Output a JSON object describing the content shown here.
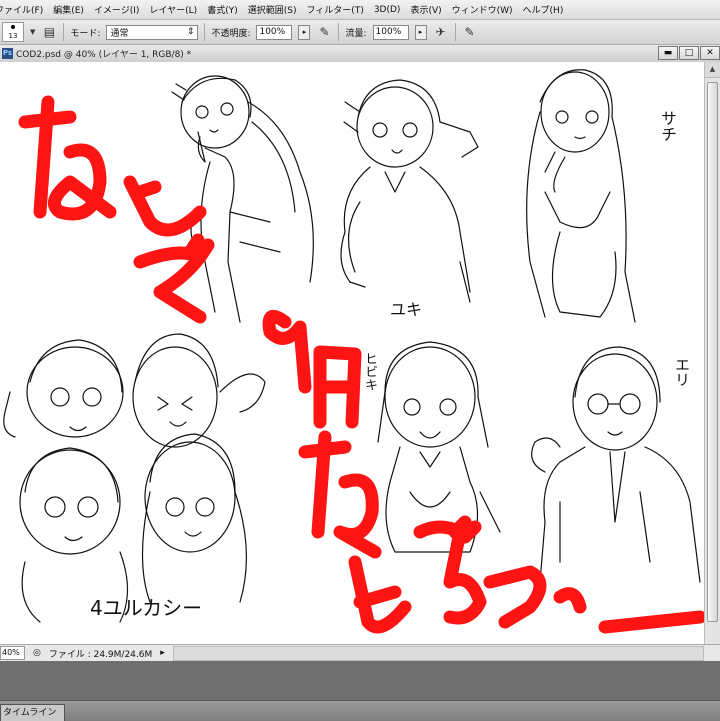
{
  "menubar": {
    "items": [
      "ファイル(F)",
      "編集(E)",
      "イメージ(I)",
      "レイヤー(L)",
      "書式(Y)",
      "選択範囲(S)",
      "フィルター(T)",
      "3D(D)",
      "表示(V)",
      "ウィンドウ(W)",
      "ヘルプ(H)"
    ]
  },
  "options": {
    "brush_size": "13",
    "mode_label": "モード:",
    "mode_value": "通常",
    "opacity_label": "不透明度:",
    "opacity_value": "100%",
    "flow_label": "流量:",
    "flow_value": "100%"
  },
  "document": {
    "title": "COD2.psd @ 40% (レイヤー 1, RGB/8) *",
    "ps_icon": "Ps"
  },
  "window_buttons": {
    "minimize": "▬",
    "restore": "□",
    "close": "✕"
  },
  "canvas": {
    "sketch_labels": {
      "yuki": "ユキ",
      "sachi": "サチ",
      "hibiki": "ヒビキ",
      "eri": "エリ",
      "quartet": "4ユルカシー"
    },
    "red_text_color": "#ff1414",
    "red_text": [
      "なんで",
      "9月",
      "なんだよ",
      "わー"
    ]
  },
  "status": {
    "zoom": "40%",
    "file_label": "ファイル : 24.9M/24.6M"
  },
  "timeline": {
    "tab_label": "タイムライン"
  }
}
